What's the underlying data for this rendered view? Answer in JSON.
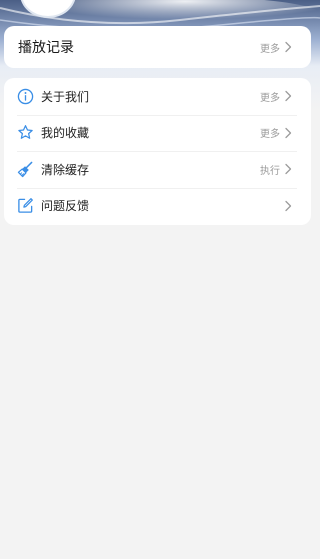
{
  "history": {
    "title": "播放记录",
    "more_label": "更多"
  },
  "menu": {
    "items": [
      {
        "label": "关于我们",
        "action": "更多",
        "icon": "info-icon"
      },
      {
        "label": "我的收藏",
        "action": "更多",
        "icon": "star-icon"
      },
      {
        "label": "清除缓存",
        "action": "执行",
        "icon": "broom-icon"
      },
      {
        "label": "问题反馈",
        "action": "",
        "icon": "edit-icon"
      }
    ]
  },
  "colors": {
    "accent": "#3a8ee6",
    "page_background": "#f3f3f3",
    "muted_text": "#9b9b9b"
  }
}
